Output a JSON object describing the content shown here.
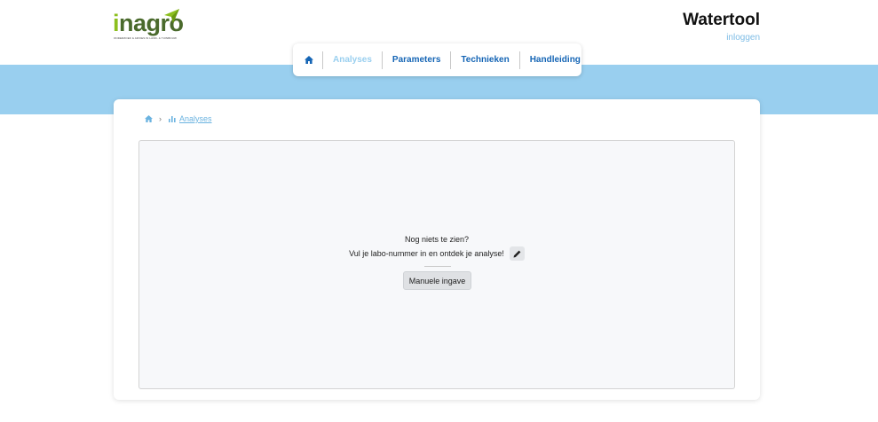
{
  "brand": {
    "logo_text_i": "i",
    "logo_text_rest": "nagro",
    "logo_tagline": "ONDERZOEK & ADVIES IN LAND- & TUINBOUW"
  },
  "header": {
    "app_title": "Watertool",
    "login_label": "inloggen"
  },
  "nav": {
    "items": [
      {
        "label": "Analyses",
        "active": true
      },
      {
        "label": "Parameters",
        "active": false
      },
      {
        "label": "Technieken",
        "active": false
      },
      {
        "label": "Handleiding",
        "active": false
      }
    ],
    "home_icon": "home-icon"
  },
  "breadcrumb": {
    "separator": "›",
    "current_label": "Analyses",
    "current_icon": "bar-chart-icon"
  },
  "empty_state": {
    "title": "Nog niets te zien?",
    "message": "Vul je labo-nummer in en ontdek je analyse!",
    "edit_icon": "pencil-icon",
    "manual_button": "Manuele ingave"
  },
  "colors": {
    "band": "#99cfef",
    "nav_text": "#1565b5",
    "nav_active": "#99cfef",
    "logo_green": "#8cbf1e"
  }
}
